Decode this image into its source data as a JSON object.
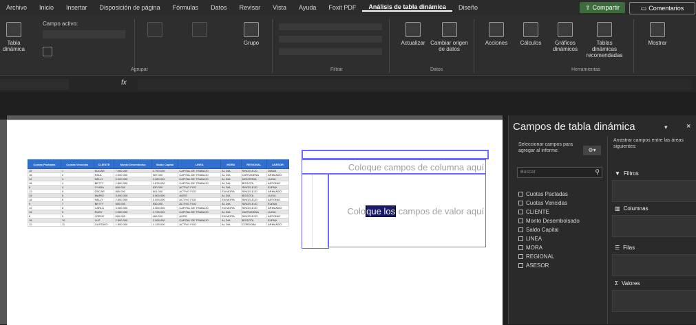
{
  "menu": {
    "tabs": [
      "Archivo",
      "Inicio",
      "Insertar",
      "Disposición de página",
      "Fórmulas",
      "Datos",
      "Revisar",
      "Vista",
      "Ayuda",
      "Foxit PDF",
      "Análisis de tabla dinámica",
      "Diseño"
    ],
    "active_tab": "Análisis de tabla dinámica",
    "share": "Compartir",
    "comments": "Comentarios"
  },
  "ribbon": {
    "tabla_dinamica": "Tabla dinámica",
    "campo_activo": "Campo activo:",
    "agrupar": "Grupo",
    "actualizar": "Actualizar",
    "cambiar_origen": "Cambiar origen de datos",
    "acciones": "Acciones",
    "calculos": "Cálculos",
    "graficos": "Gráficos dinámicos",
    "recomendadas": "Tablas dinámicas recomendadas",
    "mostrar": "Mostrar",
    "groups": {
      "agrupar": "Agrupar",
      "filtrar": "Filtrar",
      "datos": "Datos",
      "herramientas": "Herramientas"
    }
  },
  "formula": {
    "fx": "fx"
  },
  "sheet": {
    "headers": [
      "Cuotas Pactadas",
      "Cuotas Vencidas",
      "CLIENTE",
      "Monto Desembolso",
      "Saldo Capital",
      "LINEA",
      "MORA",
      "REGIONAL",
      "ASESOR"
    ],
    "rows": [
      [
        "15",
        "1",
        "EDGAR",
        "7.000.000",
        "4.750.000",
        "CAPITAL DE TRABAJO",
        "AL DIA",
        "SINCELEJO",
        "DIANA"
      ],
      [
        "18",
        "2",
        "RAUL",
        "2.000.000",
        "987.000",
        "CAPITAL DE TRABAJO",
        "AL DIA",
        "CARTAGENA",
        "ARMANDO"
      ],
      [
        "12",
        "3",
        "NELLY",
        "5.000.000",
        "2.060.000",
        "CAPITAL DE TRABAJO",
        "AL DIA",
        "MONTERIA",
        "LUISA"
      ],
      [
        "18",
        "4",
        "BETTY",
        "2.800.000",
        "1.875.000",
        "CAPITAL DE TRABAJO",
        "AL DIA",
        "BOGOTA",
        "ANTONIO"
      ],
      [
        "6",
        "4",
        "CLARA",
        "800.000",
        "530.000",
        "ACTIVO FIJO",
        "AL DIA",
        "SINCELEJO",
        "ELENA"
      ],
      [
        "12",
        "5",
        "OSCAR",
        "800.000",
        "501.000",
        "ACTIVO FIJO",
        "EN MORA",
        "SINCELEJO",
        "ARMANDO"
      ],
      [
        "15",
        "5",
        "MARIO",
        "3.000.000",
        "3.004.000",
        "AGRO",
        "AL DIA",
        "BOGOTA",
        "LUISA"
      ],
      [
        "18",
        "6",
        "NELLY",
        "2.500.000",
        "2.025.000",
        "ACTIVO FIJO",
        "EN MORA",
        "SINCELEJO",
        "ANTONIO"
      ],
      [
        "9",
        "7",
        "BETTY",
        "900.000",
        "530.000",
        "ACTIVO FIJO",
        "AL DIA",
        "SINCELEJO",
        "ELENA"
      ],
      [
        "12",
        "8",
        "CARLA",
        "3.000.000",
        "2.064.000",
        "CAPITAL DE TRABAJO",
        "EN MORA",
        "SINCELEJO",
        "ARMANDO"
      ],
      [
        "15",
        "9",
        "RUBY",
        "2.000.000",
        "1.725.000",
        "CAPITAL DE TRABAJO",
        "AL DIA",
        "CARTAGENA",
        "LUISA"
      ],
      [
        "6",
        "9",
        "JORGE",
        "600.000",
        "460.000",
        "AGRO",
        "EN MORA",
        "SINCELEJO",
        "ANTONIO"
      ],
      [
        "18",
        "10",
        "LUZ",
        "2.500.000",
        "2.006.000",
        "CAPITAL DE TRABAJO",
        "AL DIA",
        "BOGOTA",
        "ELENA"
      ],
      [
        "12",
        "11",
        "GUSTAVO",
        "1.500.000",
        "1.125.000",
        "ACTIVO FIJO",
        "AL DIA",
        "CORDOBA",
        "ARMANDO"
      ]
    ]
  },
  "pivot": {
    "columns_placeholder": "Coloque campos de columna aquí",
    "values_placeholder_pre": "Colo",
    "values_placeholder_sel": "que los",
    "values_placeholder_post": " campos de valor aquí"
  },
  "pane": {
    "title": "Campos de tabla dinámica",
    "choose_text": "Seleccionar campos para agregar al informe:",
    "drag_text": "Arrastrar campos entre las áreas siguientes:",
    "search_placeholder": "Buscar",
    "fields": [
      "Cuotas Pactadas",
      "Cuotas Vencidas",
      "CLIENTE",
      "Monto Desembolsado",
      "Saldo Capital",
      "LINEA",
      "MORA",
      "REGIONAL",
      "ASESOR"
    ],
    "areas": {
      "filters": "Filtros",
      "columns": "Columnas",
      "rows": "Filas",
      "values": "Valores"
    }
  }
}
